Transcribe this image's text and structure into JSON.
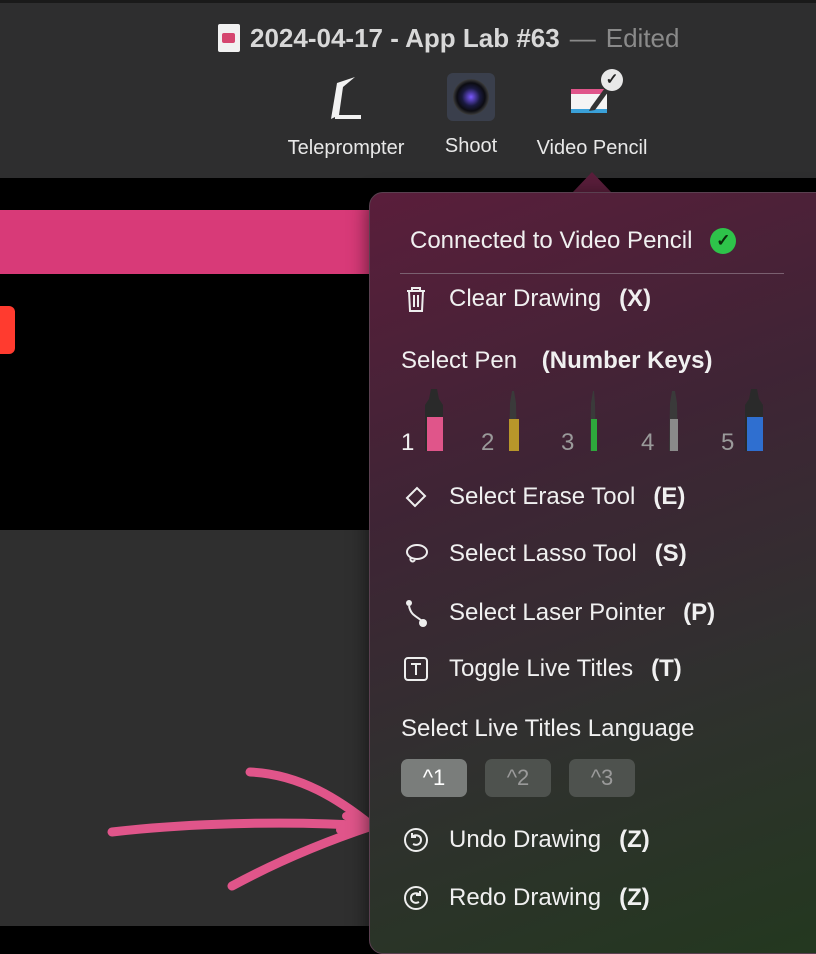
{
  "window": {
    "doc_title": "2024-04-17 - App Lab #63",
    "separator": "—",
    "edited": "Edited"
  },
  "toolbar": {
    "teleprompter": "Teleprompter",
    "shoot": "Shoot",
    "video_pencil": "Video Pencil",
    "video_pencil_badge": "✓"
  },
  "popover": {
    "status": "Connected to Video Pencil",
    "status_icon": "✓",
    "clear": {
      "label": "Clear Drawing",
      "shortcut": "(X)"
    },
    "select_pen": {
      "label": "Select Pen",
      "shortcut": "(Number Keys)"
    },
    "pens": [
      {
        "number": "1",
        "color": "#e0558a"
      },
      {
        "number": "2",
        "color": "#b8962a"
      },
      {
        "number": "3",
        "color": "#2ea83c"
      },
      {
        "number": "4",
        "color": "#8a8a8a"
      },
      {
        "number": "5",
        "color": "#2f6fd0"
      }
    ],
    "erase": {
      "label": "Select Erase Tool",
      "shortcut": "(E)"
    },
    "lasso": {
      "label": "Select Lasso Tool",
      "shortcut": "(S)"
    },
    "laser": {
      "label": "Select Laser Pointer",
      "shortcut": "(P)"
    },
    "titles": {
      "label": "Toggle Live Titles",
      "shortcut": "(T)"
    },
    "language": {
      "label": "Select Live Titles Language"
    },
    "language_keys": [
      "^1",
      "^2",
      "^3"
    ],
    "undo": {
      "label": "Undo Drawing",
      "shortcut": "(Z)"
    },
    "redo": {
      "label": "Redo Drawing",
      "shortcut": "(Z)"
    }
  },
  "colors": {
    "accent_pink": "#d83a78",
    "connected_green": "#2ec34a",
    "record_red": "#ff3b2f"
  }
}
